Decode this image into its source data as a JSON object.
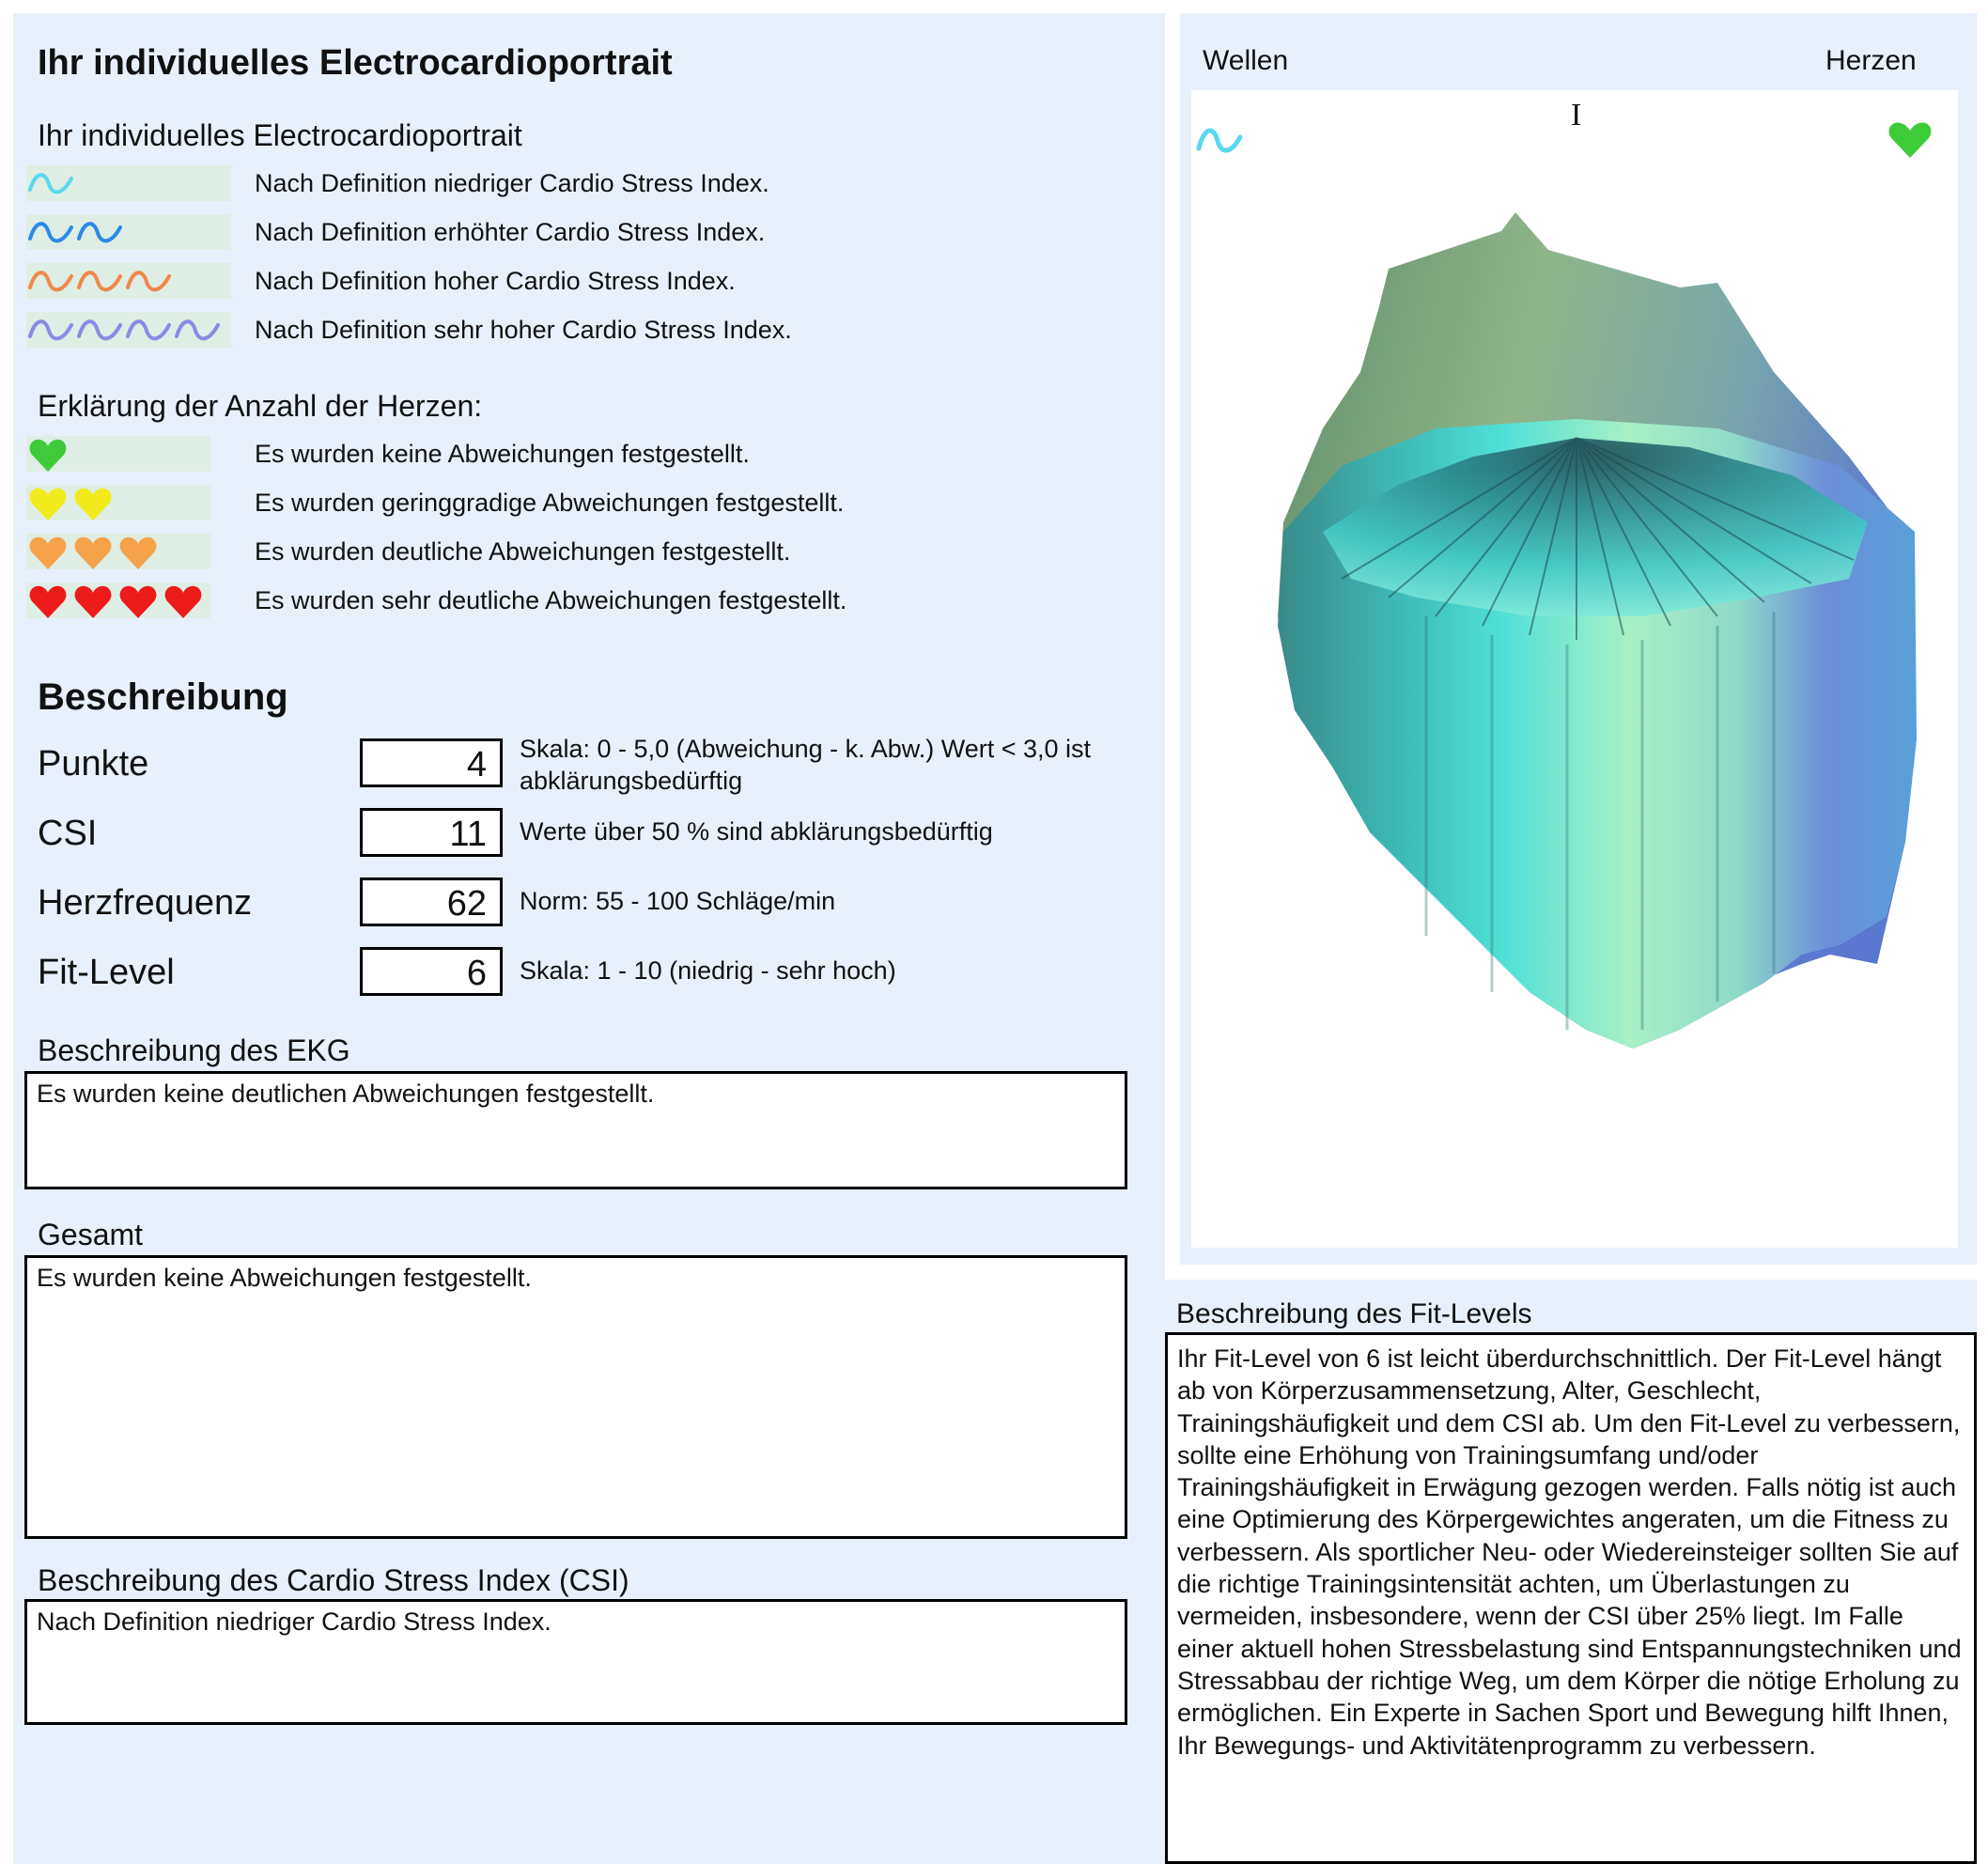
{
  "header": {
    "title": "Ihr individuelles Electrocardioportrait",
    "subtitle": "Ihr individuelles Electrocardioportrait"
  },
  "waves_legend": {
    "items": [
      {
        "count": 1,
        "color": "#5ad8f0",
        "text": "Nach Definition niedriger Cardio Stress Index."
      },
      {
        "count": 2,
        "color": "#2a8ae8",
        "text": "Nach Definition erhöhter Cardio Stress Index."
      },
      {
        "count": 3,
        "color": "#f0884a",
        "text": "Nach Definition hoher Cardio Stress Index."
      },
      {
        "count": 4,
        "color": "#8a8ae8",
        "text": "Nach Definition sehr hoher Cardio Stress Index."
      }
    ]
  },
  "hearts_legend": {
    "heading": "Erklärung der Anzahl der Herzen:",
    "items": [
      {
        "count": 1,
        "color": "#3ecb3a",
        "text": "Es wurden keine Abweichungen festgestellt."
      },
      {
        "count": 2,
        "color": "#f2ea1a",
        "text": "Es wurden geringgradige Abweichungen festgestellt."
      },
      {
        "count": 3,
        "color": "#f5a24a",
        "text": "Es wurden deutliche Abweichungen festgestellt."
      },
      {
        "count": 4,
        "color": "#ee1b1b",
        "text": "Es wurden sehr deutliche Abweichungen festgestellt."
      }
    ]
  },
  "description": {
    "heading": "Beschreibung",
    "metrics": [
      {
        "label": "Punkte",
        "value": "4",
        "note": "Skala: 0 - 5,0 (Abweichung - k. Abw.) Wert < 3,0 ist abklärungsbedürftig"
      },
      {
        "label": "CSI",
        "value": "11",
        "note": "Werte über 50 % sind abklärungsbedürftig"
      },
      {
        "label": "Herzfrequenz",
        "value": "62",
        "note": "Norm: 55 - 100 Schläge/min"
      },
      {
        "label": "Fit-Level",
        "value": "6",
        "note": "Skala: 1 - 10 (niedrig - sehr hoch)"
      }
    ]
  },
  "ekg": {
    "label": "Beschreibung des EKG",
    "text": "Es wurden keine deutlichen Abweichungen festgestellt."
  },
  "gesamt": {
    "label": "Gesamt",
    "text": "Es wurden keine Abweichungen festgestellt."
  },
  "csi_desc": {
    "label": "Beschreibung des Cardio Stress Index (CSI)",
    "text": "Nach Definition niedriger Cardio Stress Index."
  },
  "viewer": {
    "label_left": "Wellen",
    "label_right": "Herzen",
    "wave_color": "#5ad8f0",
    "heart_color": "#3ecb3a",
    "cursor_glyph": "I"
  },
  "fit_levels": {
    "label": "Beschreibung des Fit-Levels",
    "text": "Ihr Fit-Level von 6 ist leicht überdurchschnittlich. Der Fit-Level hängt ab von Körperzusammensetzung, Alter, Geschlecht, Trainingshäufigkeit und dem CSI ab. Um den Fit-Level zu verbessern, sollte eine Erhöhung von Trainingsumfang und/oder Trainingshäufigkeit in Erwägung gezogen werden. Falls nötig ist auch eine Optimierung des Körpergewichtes angeraten, um die Fitness zu verbessern. Als sportlicher Neu- oder Wiedereinsteiger sollten Sie auf die richtige Trainingsintensität achten, um Überlastungen zu vermeiden, insbesondere, wenn der CSI über 25% liegt. Im Falle einer aktuell hohen Stressbelastung sind Entspannungstechniken und Stressabbau der richtige Weg, um dem Körper die nötige Erholung zu ermöglichen. Ein Experte in Sachen Sport und Bewegung hilft Ihnen, Ihr Bewegungs- und Aktivitätenprogramm zu verbessern."
  }
}
